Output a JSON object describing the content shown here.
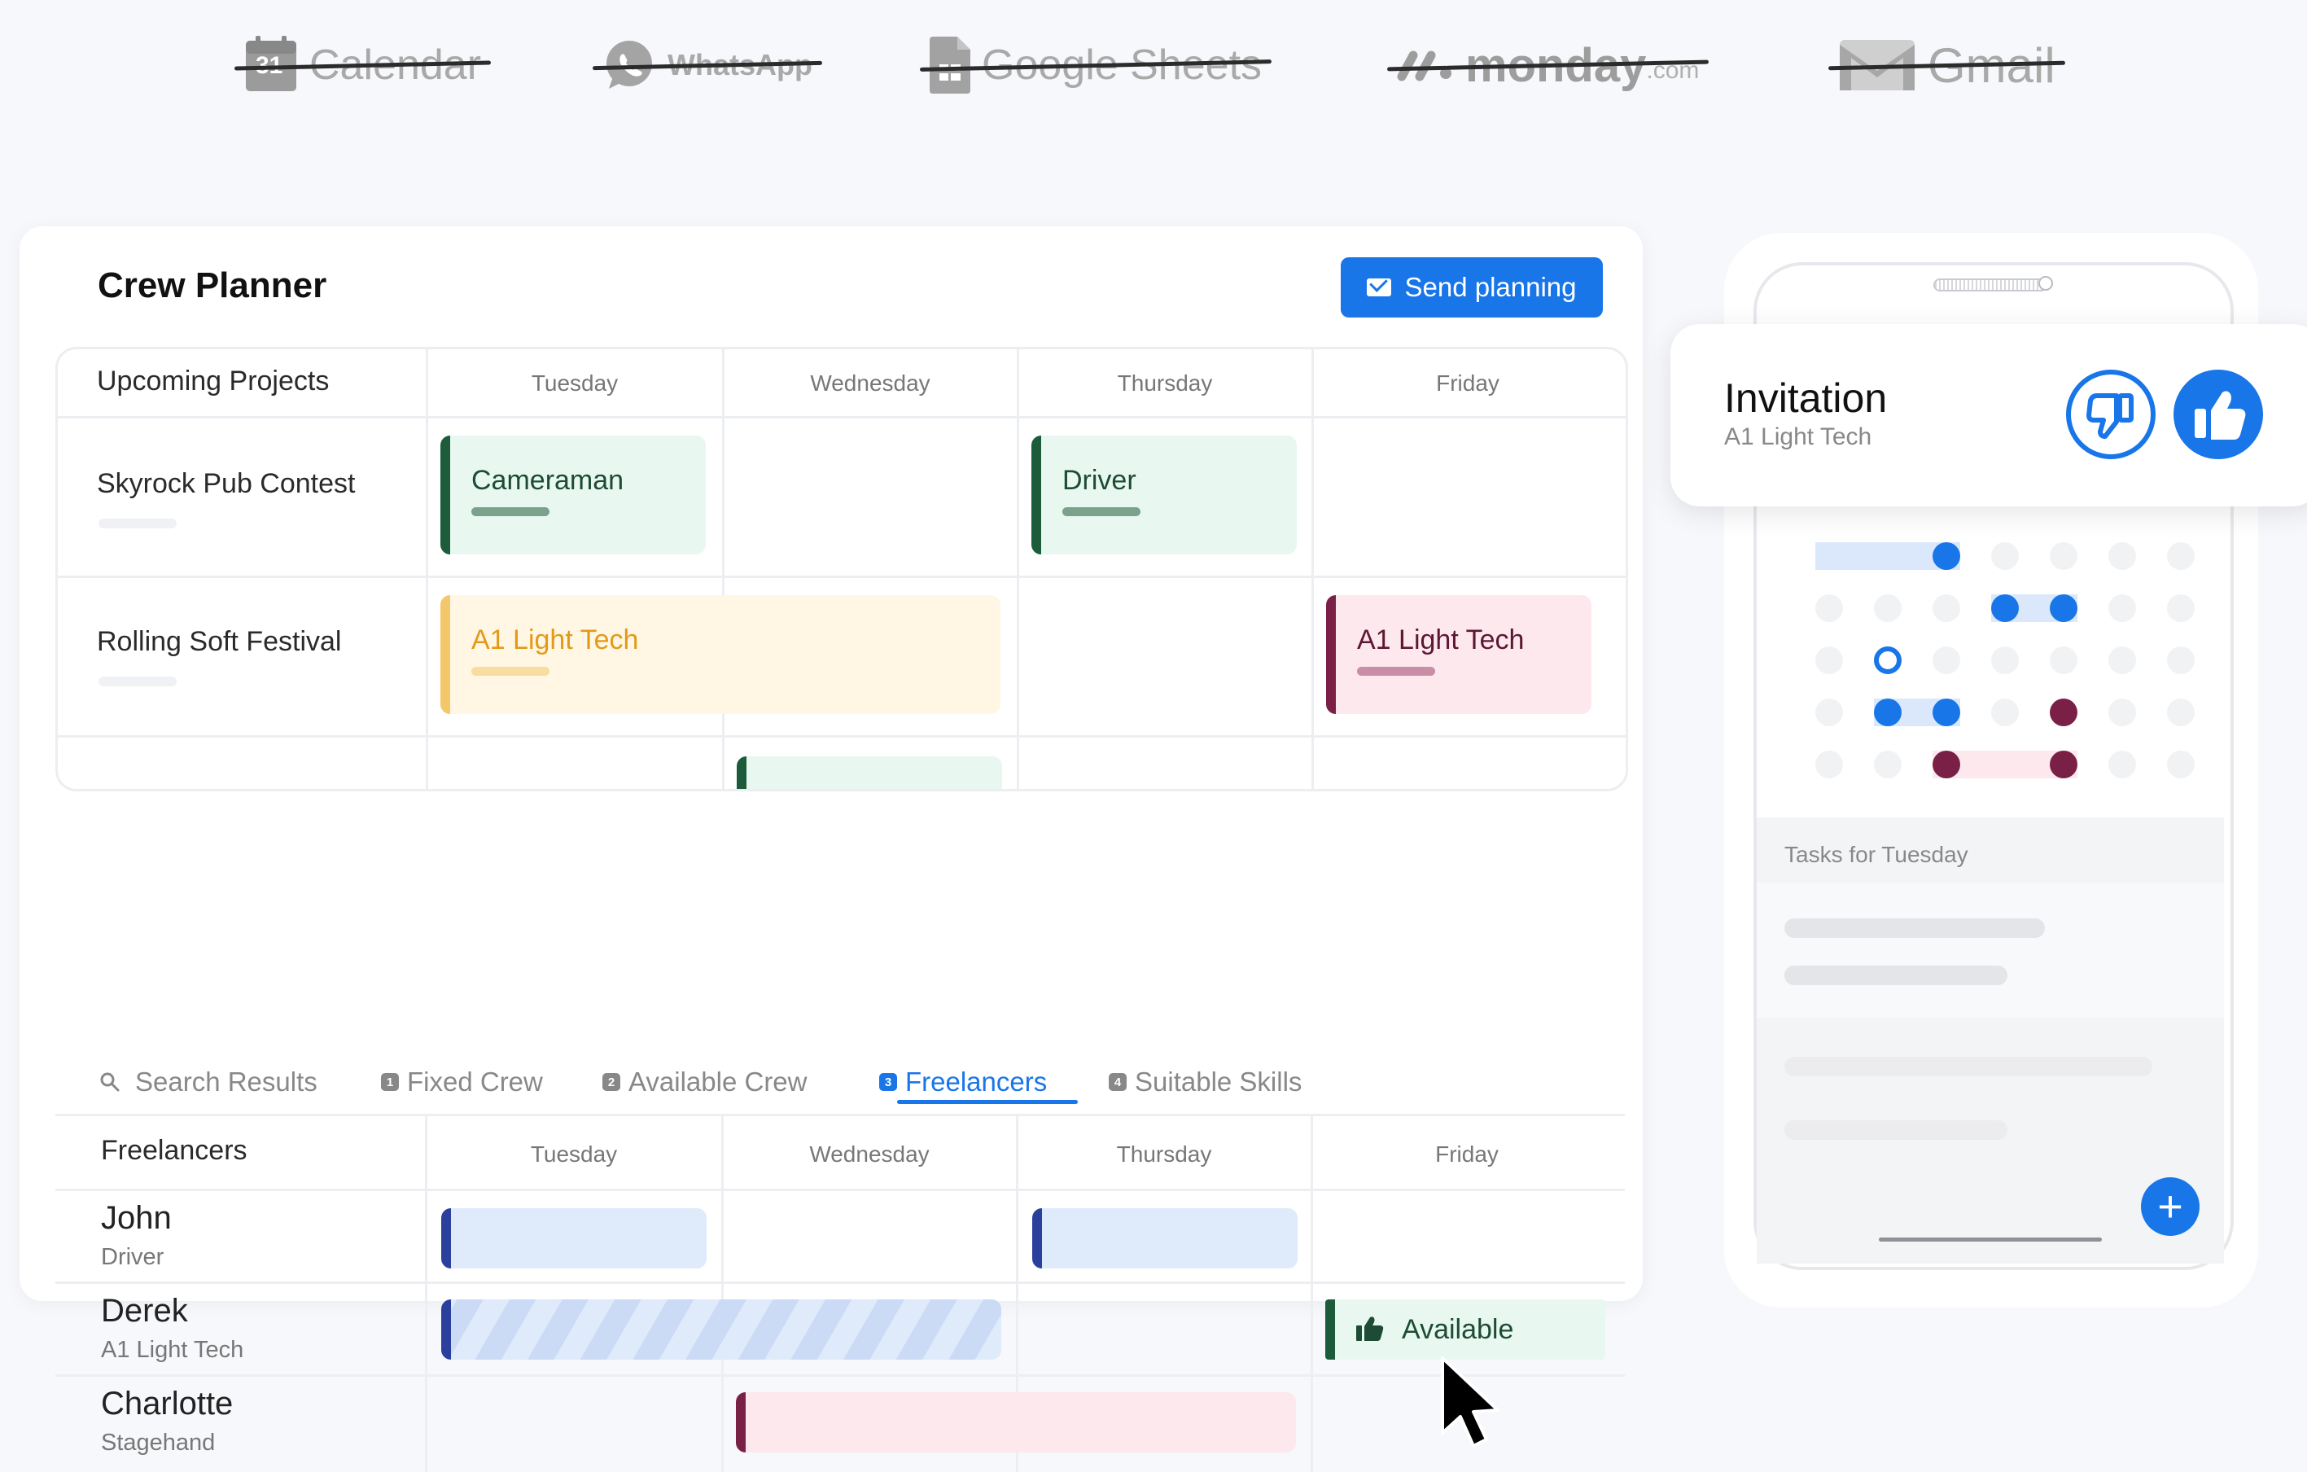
{
  "logos": [
    {
      "name": "Calendar",
      "icon": "calendar-icon",
      "badge": "31"
    },
    {
      "name": "WhatsApp",
      "icon": "whatsapp-icon"
    },
    {
      "name": "Google Sheets",
      "icon": "sheets-icon"
    },
    {
      "name": "monday",
      "suffix": ".com",
      "icon": "monday-icon"
    },
    {
      "name": "Gmail",
      "icon": "gmail-icon"
    }
  ],
  "planner": {
    "title": "Crew Planner",
    "send_button": "Send planning",
    "projects_header": "Upcoming Projects",
    "days": [
      "Tuesday",
      "Wednesday",
      "Thursday",
      "Friday"
    ],
    "projects": [
      {
        "name": "Skyrock Pub Contest"
      },
      {
        "name": "Rolling Soft Festival"
      }
    ],
    "tasks": {
      "cameraman": "Cameraman",
      "driver": "Driver",
      "a1_tuesday": "A1 Light Tech",
      "a1_friday": "A1 Light Tech"
    }
  },
  "tabs": [
    {
      "label": "Search Results",
      "icon": "search-icon"
    },
    {
      "label": "Fixed Crew",
      "badge": "1"
    },
    {
      "label": "Available Crew",
      "badge": "2"
    },
    {
      "label": "Freelancers",
      "badge": "3",
      "active": true
    },
    {
      "label": "Suitable Skills",
      "badge": "4"
    }
  ],
  "freelancers": {
    "header": "Freelancers",
    "days": [
      "Tuesday",
      "Wednesday",
      "Thursday",
      "Friday"
    ],
    "rows": [
      {
        "name": "John",
        "role": "Driver"
      },
      {
        "name": "Derek",
        "role": "A1 Light Tech"
      },
      {
        "name": "Charlotte",
        "role": "Stagehand"
      }
    ],
    "available_label": "Available"
  },
  "invitation": {
    "title": "Invitation",
    "subtitle": "A1 Light Tech"
  },
  "phone": {
    "tasks_title": "Tasks for Tuesday",
    "fab_label": "+"
  },
  "colors": {
    "accent": "#1976e8",
    "green": "#1d5c3a",
    "green_bg": "#e8f8f1",
    "yellow": "#f5c76b",
    "yellow_bg": "#fff7e3",
    "maroon": "#7a2047",
    "pink_bg": "#fde8ee",
    "navy": "#2b3f9c",
    "blue_bg": "#dfeafb"
  }
}
